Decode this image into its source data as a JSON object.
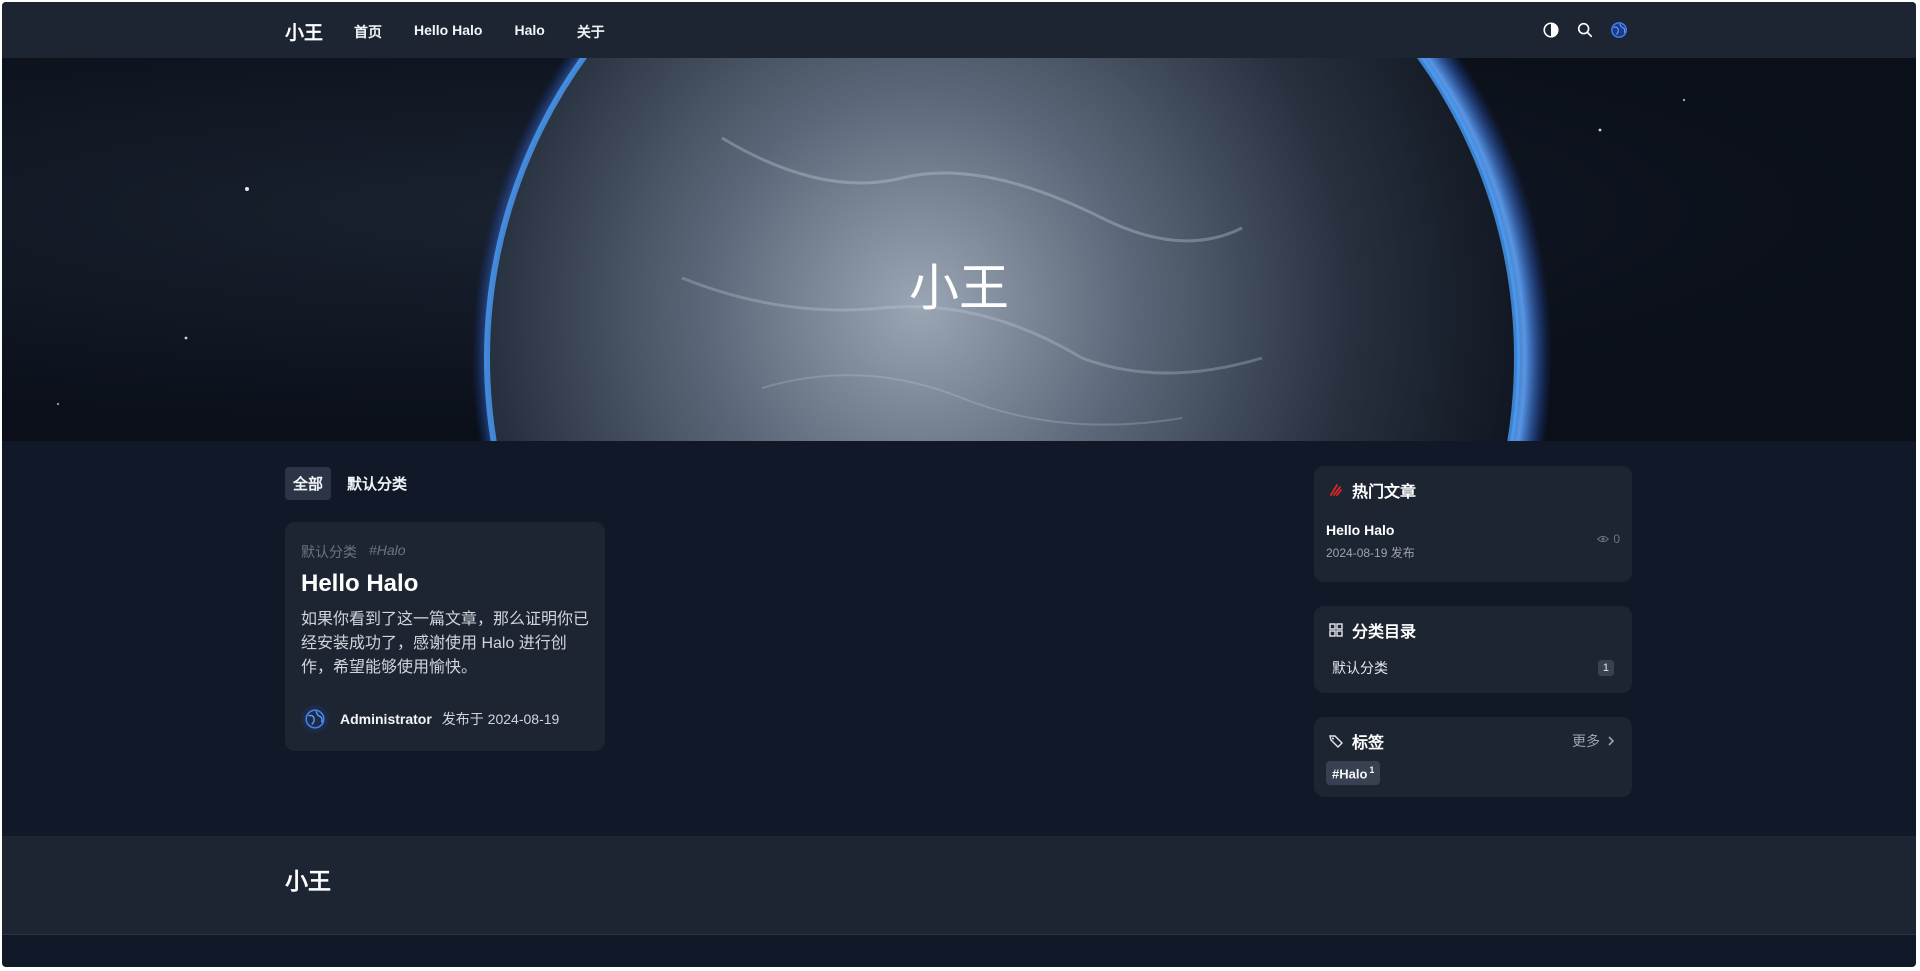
{
  "header": {
    "brand": "小王",
    "nav": [
      "首页",
      "Hello Halo",
      "Halo",
      "关于"
    ],
    "icons": [
      "theme-toggle-icon",
      "search-icon",
      "avatar-globe-icon"
    ]
  },
  "hero": {
    "title": "小王"
  },
  "tabs": {
    "items": [
      "全部",
      "默认分类"
    ],
    "active": "全部"
  },
  "post": {
    "category": "默认分类",
    "tag": "#Halo",
    "title": "Hello Halo",
    "excerpt": "如果你看到了这一篇文章，那么证明你已经安装成功了，感谢使用 Halo 进行创作，希望能够使用愉快。",
    "author": "Administrator",
    "date": "发布于 2024-08-19"
  },
  "sidebar": {
    "hot": {
      "title": "热门文章",
      "items": [
        {
          "title": "Hello Halo",
          "date": "2024-08-19 发布",
          "views": "0"
        }
      ]
    },
    "categories": {
      "title": "分类目录",
      "items": [
        {
          "name": "默认分类",
          "count": "1"
        }
      ]
    },
    "tags": {
      "title": "标签",
      "more": "更多",
      "items": [
        {
          "name": "#Halo",
          "count": "1"
        }
      ]
    }
  },
  "footer": {
    "brand": "小王"
  },
  "colors": {
    "background": "#111827",
    "surface": "#1e2532",
    "accent": "#3b82f6",
    "hot": "#dc2626"
  }
}
